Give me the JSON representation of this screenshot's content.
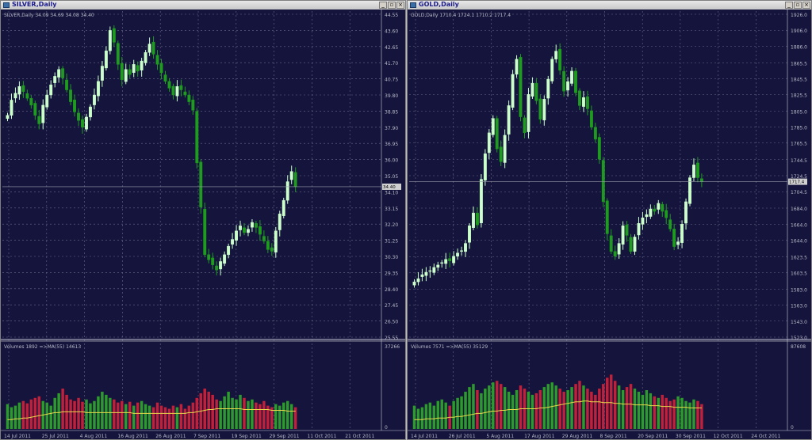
{
  "colors": {
    "background": "#14143c",
    "grid": "#6a6a8a",
    "bull": "#ccffcc",
    "bear": "#1f9b1f",
    "volume_up": "#2c9a2c",
    "volume_down": "#c0203a",
    "ma_line": "#e8d84a",
    "text": "#b8b8c8",
    "window_frame": "#d4d0c8"
  },
  "windows": [
    {
      "id": "silver",
      "title": "SILVER,Daily",
      "info": "SILVER,Daily  34.09 34.69 34.08 34.40",
      "volume_label": "Volumes 1892  =>MA(55) 14613",
      "volume_max": "37266",
      "volume_zero": "0",
      "price_tag": "34.40",
      "controls": [
        "minimize-icon",
        "restore-icon",
        "close-icon"
      ],
      "chart_data": {
        "type": "candlestick",
        "symbol": "SILVER",
        "timeframe": "Daily",
        "ohlc_current": {
          "open": 34.09,
          "high": 34.69,
          "low": 34.08,
          "close": 34.4
        },
        "ylim": [
          25.55,
          44.55
        ],
        "y_ticks": [
          "44.55",
          "43.60",
          "42.65",
          "41.70",
          "40.75",
          "39.80",
          "38.85",
          "37.90",
          "36.95",
          "36.00",
          "35.05",
          "34.10",
          "33.15",
          "32.20",
          "31.25",
          "30.30",
          "29.35",
          "28.40",
          "27.45",
          "26.50",
          "25.55"
        ],
        "x_ticks": [
          "14 Jul 2011",
          "25 Jul 2011",
          "4 Aug 2011",
          "16 Aug 2011",
          "26 Aug 2011",
          "7 Sep 2011",
          "19 Sep 2011",
          "29 Sep 2011",
          "11 Oct 2011",
          "21 Oct 2011"
        ],
        "closes": [
          38.6,
          39.5,
          39.9,
          40.3,
          40.0,
          39.6,
          39.2,
          38.6,
          38.1,
          39.2,
          39.8,
          40.4,
          40.9,
          41.3,
          40.8,
          40.1,
          39.4,
          38.8,
          38.3,
          37.9,
          38.5,
          39.1,
          39.8,
          40.6,
          41.5,
          42.4,
          43.6,
          42.9,
          41.6,
          40.7,
          41.3,
          41.0,
          41.6,
          41.2,
          41.8,
          42.3,
          42.8,
          42.2,
          41.6,
          41.1,
          40.6,
          40.2,
          39.8,
          40.3,
          40.1,
          39.8,
          39.4,
          38.9,
          35.8,
          33.2,
          30.4,
          30.1,
          29.8,
          29.5,
          30.0,
          30.4,
          30.9,
          31.3,
          31.8,
          32.1,
          31.7,
          31.9,
          32.3,
          32.0,
          31.6,
          31.2,
          30.7,
          30.6,
          31.8,
          32.8,
          33.6,
          34.7,
          35.3,
          34.4
        ]
      },
      "volume_chart": {
        "type": "bar",
        "ma_period": 55,
        "volume_level_pct": [
          32,
          28,
          30,
          34,
          36,
          33,
          38,
          40,
          42,
          36,
          34,
          30,
          40,
          46,
          52,
          44,
          38,
          36,
          40,
          35,
          38,
          33,
          36,
          42,
          48,
          44,
          40,
          38,
          34,
          36,
          32,
          35,
          30,
          34,
          36,
          32,
          30,
          28,
          34,
          30,
          28,
          26,
          30,
          28,
          32,
          26,
          30,
          34,
          40,
          46,
          52,
          48,
          44,
          38,
          36,
          42,
          48,
          40,
          38,
          44,
          40,
          36,
          38,
          34,
          32,
          36,
          30,
          28,
          32,
          30,
          34,
          36,
          32,
          28
        ],
        "ma_level_pct": [
          12,
          12,
          13,
          13,
          14,
          14,
          15,
          16,
          17,
          18,
          19,
          20,
          21,
          21,
          22,
          22,
          22,
          22,
          22,
          22,
          21,
          21,
          21,
          21,
          21,
          21,
          21,
          21,
          21,
          21,
          21,
          21,
          20,
          20,
          20,
          20,
          20,
          20,
          20,
          20,
          20,
          20,
          20,
          20,
          20,
          20,
          21,
          21,
          22,
          23,
          24,
          25,
          25,
          26,
          26,
          26,
          26,
          26,
          26,
          26,
          25,
          25,
          25,
          25,
          25,
          25,
          25,
          24,
          24,
          24,
          24,
          23,
          23,
          23
        ]
      }
    },
    {
      "id": "gold",
      "title": "GOLD,Daily",
      "info": "GOLD,Daily  1710.4 1724.1 1710.2 1717.4",
      "volume_label": "Volumes 7571  =>MA(55) 35129",
      "volume_max": "87608",
      "volume_zero": "0",
      "price_tag": "1717.4",
      "controls": [
        "minimize-icon",
        "restore-icon",
        "close-icon"
      ],
      "chart_data": {
        "type": "candlestick",
        "symbol": "GOLD",
        "timeframe": "Daily",
        "ohlc_current": {
          "open": 1710.4,
          "high": 1724.1,
          "low": 1710.2,
          "close": 1717.4
        },
        "ylim": [
          1523.0,
          1926.0
        ],
        "y_ticks": [
          "1926.0",
          "1906.0",
          "1886.0",
          "1865.5",
          "1845.5",
          "1825.5",
          "1805.0",
          "1785.0",
          "1765.5",
          "1744.5",
          "1724.5",
          "1704.5",
          "1684.0",
          "1664.0",
          "1644.0",
          "1623.5",
          "1603.5",
          "1583.0",
          "1563.0",
          "1543.0",
          "1523.0"
        ],
        "x_ticks": [
          "14 Jul 2011",
          "26 Jul 2011",
          "5 Aug 2011",
          "17 Aug 2011",
          "29 Aug 2011",
          "8 Sep 2011",
          "20 Sep 2011",
          "30 Sep 2011",
          "12 Oct 2011",
          "24 Oct 2011"
        ],
        "closes": [
          1592,
          1596,
          1601,
          1604,
          1606,
          1610,
          1613,
          1616,
          1620,
          1618,
          1624,
          1628,
          1631,
          1640,
          1662,
          1678,
          1663,
          1720,
          1752,
          1778,
          1796,
          1758,
          1742,
          1775,
          1812,
          1851,
          1870,
          1798,
          1778,
          1826,
          1840,
          1818,
          1795,
          1820,
          1845,
          1870,
          1880,
          1856,
          1830,
          1842,
          1855,
          1828,
          1812,
          1822,
          1808,
          1785,
          1770,
          1745,
          1692,
          1652,
          1630,
          1624,
          1640,
          1662,
          1650,
          1630,
          1648,
          1665,
          1672,
          1676,
          1683,
          1680,
          1690,
          1680,
          1672,
          1658,
          1636,
          1642,
          1664,
          1692,
          1722,
          1738,
          1722,
          1717
        ]
      },
      "volume_chart": {
        "type": "bar",
        "ma_period": 55,
        "volume_level_pct": [
          30,
          26,
          28,
          32,
          34,
          30,
          36,
          38,
          34,
          30,
          36,
          40,
          42,
          48,
          54,
          58,
          50,
          46,
          52,
          56,
          60,
          62,
          58,
          54,
          48,
          44,
          50,
          56,
          52,
          48,
          44,
          46,
          50,
          54,
          58,
          60,
          56,
          52,
          48,
          50,
          54,
          58,
          62,
          56,
          52,
          48,
          44,
          52,
          58,
          66,
          70,
          62,
          56,
          50,
          54,
          58,
          52,
          48,
          44,
          50,
          46,
          42,
          40,
          44,
          40,
          36,
          38,
          42,
          40,
          36,
          34,
          38,
          36,
          32
        ],
        "ma_level_pct": [
          12,
          12,
          12,
          13,
          13,
          13,
          14,
          14,
          14,
          15,
          15,
          16,
          16,
          17,
          18,
          19,
          20,
          20,
          21,
          22,
          23,
          23,
          24,
          24,
          25,
          25,
          25,
          26,
          26,
          26,
          26,
          26,
          27,
          27,
          28,
          29,
          30,
          31,
          32,
          33,
          34,
          35,
          35,
          36,
          36,
          35,
          35,
          35,
          34,
          34,
          34,
          33,
          33,
          32,
          32,
          32,
          31,
          31,
          31,
          31,
          30,
          30,
          30,
          29,
          29,
          29,
          28,
          28,
          28,
          28,
          27,
          27,
          27,
          27
        ]
      }
    }
  ]
}
